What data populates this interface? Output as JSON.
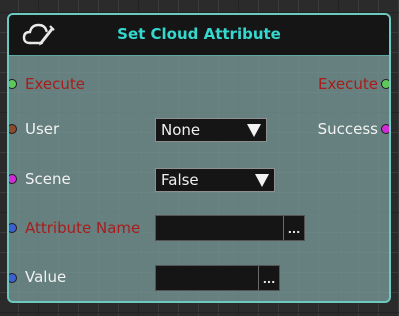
{
  "node": {
    "title": "Set Cloud Attribute",
    "icon": "cloud-edit-icon"
  },
  "pins": {
    "execute_in": "Execute",
    "execute_out": "Execute",
    "user": "User",
    "success": "Success",
    "scene": "Scene",
    "attribute_name": "Attribute Name",
    "value": "Value"
  },
  "inputs": {
    "user_selected": "None",
    "scene_selected": "False",
    "attribute_name_value": "",
    "value_value": "",
    "browse_label": "..."
  },
  "colors": {
    "title": "#35d8cf",
    "node_border": "#6cc9c1",
    "exec_pin": "#5ec95a",
    "required_label": "#a81c1c",
    "bool_pin": "#d12bd6",
    "string_pin": "#3d5fcf",
    "user_pin": "#8a4a2c"
  }
}
